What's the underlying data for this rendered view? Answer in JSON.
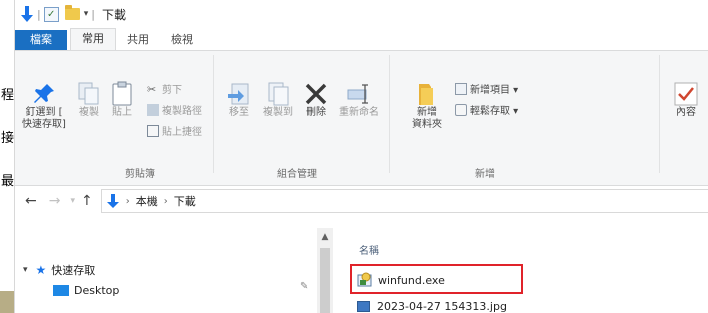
{
  "side_text": [
    "程",
    "接",
    "最"
  ],
  "titlebar": {
    "title": "下載",
    "separator": "|",
    "dropdown_glyph": "▾"
  },
  "tabs": [
    {
      "label": "檔案"
    },
    {
      "label": "常用"
    },
    {
      "label": "共用"
    },
    {
      "label": "檢視"
    }
  ],
  "ribbon": {
    "clipboard": {
      "pin_label": "釘選到 [\n快速存取]",
      "copy_label": "複製",
      "paste_label": "貼上",
      "cut_label": "剪下",
      "copy_path_label": "複製路徑",
      "paste_shortcut_label": "貼上捷徑",
      "group_label": "剪貼簿"
    },
    "organize": {
      "move_label": "移至",
      "copy_to_label": "複製到",
      "delete_label": "刪除",
      "rename_label": "重新命名",
      "group_label": "組合管理"
    },
    "new": {
      "new_folder_label": "新增\n資料夾",
      "new_item_label": "新增項目 ▾",
      "easy_access_label": "輕鬆存取 ▾",
      "group_label": "新增"
    },
    "open": {
      "properties_label": "內容"
    }
  },
  "address": {
    "back": "←",
    "forward": "→",
    "recent": "▾",
    "up": "↑",
    "crumbs": [
      "本機",
      "下載"
    ]
  },
  "nav_pane": {
    "quick_access_label": "快速存取",
    "expand_glyph": "▾",
    "desktop_label": "Desktop",
    "pin_glyph": "✎"
  },
  "files": {
    "column_name": "名稱",
    "items": [
      {
        "name": "winfund.exe"
      },
      {
        "name": "2023-04-27 154313.jpg"
      }
    ]
  },
  "colors": {
    "file_tab": "#1a6fc2",
    "highlight": "#e0232a",
    "accent_arrow": "#1a73e8"
  }
}
